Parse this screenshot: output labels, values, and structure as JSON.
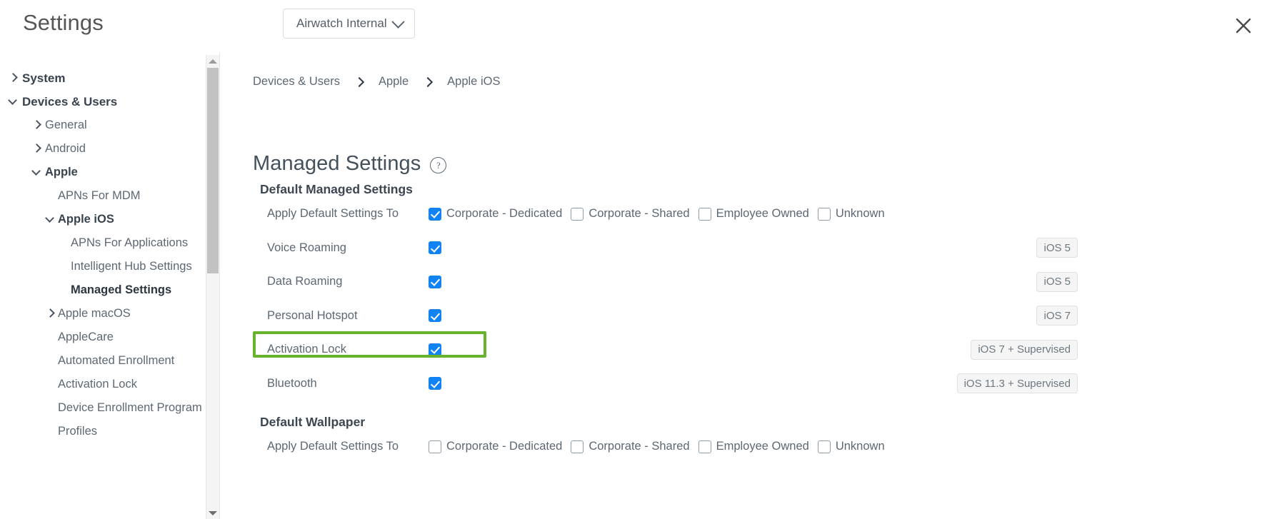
{
  "header": {
    "title": "Settings",
    "org_selector": {
      "label": "Airwatch Internal",
      "caret_icon": "chevron-down-icon"
    },
    "close_icon": "close-icon"
  },
  "sidebar": {
    "items": [
      {
        "label": "System",
        "level": 0,
        "chevron": "collapsed",
        "bold": true,
        "selected": false
      },
      {
        "label": "Devices & Users",
        "level": 0,
        "chevron": "expanded",
        "bold": true,
        "selected": false
      },
      {
        "label": "General",
        "level": 1,
        "chevron": "collapsed",
        "bold": false,
        "selected": false
      },
      {
        "label": "Android",
        "level": 1,
        "chevron": "collapsed",
        "bold": false,
        "selected": false
      },
      {
        "label": "Apple",
        "level": 1,
        "chevron": "expanded",
        "bold": true,
        "selected": false
      },
      {
        "label": "APNs For MDM",
        "level": 2,
        "chevron": "none",
        "bold": false,
        "selected": false
      },
      {
        "label": "Apple iOS",
        "level": 2,
        "chevron": "expanded",
        "bold": true,
        "selected": false
      },
      {
        "label": "APNs For Applications",
        "level": 3,
        "chevron": "none",
        "bold": false,
        "selected": false
      },
      {
        "label": "Intelligent Hub Settings",
        "level": 3,
        "chevron": "none",
        "bold": false,
        "selected": false
      },
      {
        "label": "Managed Settings",
        "level": 3,
        "chevron": "none",
        "bold": true,
        "selected": true
      },
      {
        "label": "Apple macOS",
        "level": 2,
        "chevron": "collapsed",
        "bold": false,
        "selected": false
      },
      {
        "label": "AppleCare",
        "level": 2,
        "chevron": "none",
        "bold": false,
        "selected": false
      },
      {
        "label": "Automated Enrollment",
        "level": 2,
        "chevron": "none",
        "bold": false,
        "selected": false
      },
      {
        "label": "Activation Lock",
        "level": 2,
        "chevron": "none",
        "bold": false,
        "selected": false
      },
      {
        "label": "Device Enrollment Program",
        "level": 2,
        "chevron": "none",
        "bold": false,
        "selected": false
      },
      {
        "label": "Profiles",
        "level": 2,
        "chevron": "none",
        "bold": false,
        "selected": false
      }
    ],
    "scrollbar": {
      "up_icon": "scroll-up-arrow-icon",
      "down_icon": "scroll-down-arrow-icon"
    }
  },
  "main": {
    "breadcrumb": [
      "Devices & Users",
      "Apple",
      "Apple iOS"
    ],
    "page_title": "Managed Settings",
    "help_icon_glyph": "?",
    "sections": [
      {
        "title": "Default Managed Settings",
        "rows": [
          {
            "label": "Apply Default Settings To",
            "type": "checkbox-group",
            "options": [
              {
                "label": "Corporate - Dedicated",
                "checked": true
              },
              {
                "label": "Corporate - Shared",
                "checked": false
              },
              {
                "label": "Employee Owned",
                "checked": false
              },
              {
                "label": "Unknown",
                "checked": false
              }
            ],
            "badge": ""
          },
          {
            "label": "Voice Roaming",
            "type": "checkbox",
            "checked": true,
            "badge": "iOS 5"
          },
          {
            "label": "Data Roaming",
            "type": "checkbox",
            "checked": true,
            "badge": "iOS 5"
          },
          {
            "label": "Personal Hotspot",
            "type": "checkbox",
            "checked": true,
            "badge": "iOS 7"
          },
          {
            "label": "Activation Lock",
            "type": "checkbox",
            "checked": true,
            "badge": "iOS 7 + Supervised",
            "highlighted": true
          },
          {
            "label": "Bluetooth",
            "type": "checkbox",
            "checked": true,
            "badge": "iOS 11.3 + Supervised"
          }
        ]
      },
      {
        "title": "Default Wallpaper",
        "rows": [
          {
            "label": "Apply Default Settings To",
            "type": "checkbox-group",
            "options": [
              {
                "label": "Corporate - Dedicated",
                "checked": false
              },
              {
                "label": "Corporate - Shared",
                "checked": false
              },
              {
                "label": "Employee Owned",
                "checked": false
              },
              {
                "label": "Unknown",
                "checked": false
              }
            ],
            "badge": ""
          }
        ]
      }
    ]
  },
  "colors": {
    "checkbox_checked": "#1283f5",
    "highlight_border": "#67b32e",
    "text": "#5d6873",
    "badge_bg": "#f5f5f5"
  }
}
